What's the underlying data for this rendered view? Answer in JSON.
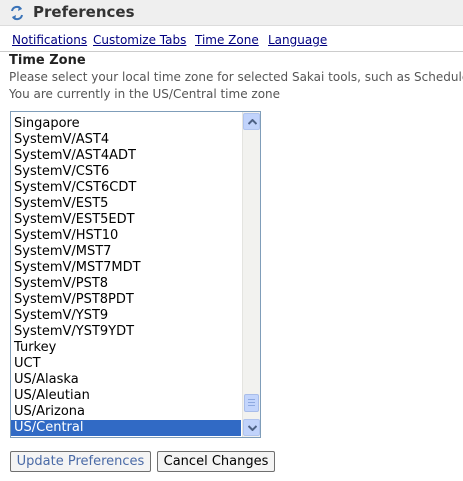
{
  "header": {
    "title": "Preferences",
    "icon": "refresh-arrows-icon"
  },
  "nav": {
    "links": [
      "Notifications",
      "Customize Tabs",
      "Time Zone",
      "Language"
    ]
  },
  "section": {
    "heading": "Time Zone",
    "instruction": "Please select your local time zone for selected Sakai tools, such as Schedule.",
    "current": "You are currently in the US/Central time zone"
  },
  "timezone_list": {
    "options": [
      "Singapore",
      "SystemV/AST4",
      "SystemV/AST4ADT",
      "SystemV/CST6",
      "SystemV/CST6CDT",
      "SystemV/EST5",
      "SystemV/EST5EDT",
      "SystemV/HST10",
      "SystemV/MST7",
      "SystemV/MST7MDT",
      "SystemV/PST8",
      "SystemV/PST8PDT",
      "SystemV/YST9",
      "SystemV/YST9YDT",
      "Turkey",
      "UCT",
      "US/Alaska",
      "US/Aleutian",
      "US/Arizona",
      "US/Central"
    ],
    "selected": "US/Central",
    "selected_color": "#316ac5"
  },
  "buttons": {
    "update": "Update Preferences",
    "cancel": "Cancel Changes"
  },
  "colors": {
    "link": "#000080",
    "title_bar": "#efefef"
  }
}
